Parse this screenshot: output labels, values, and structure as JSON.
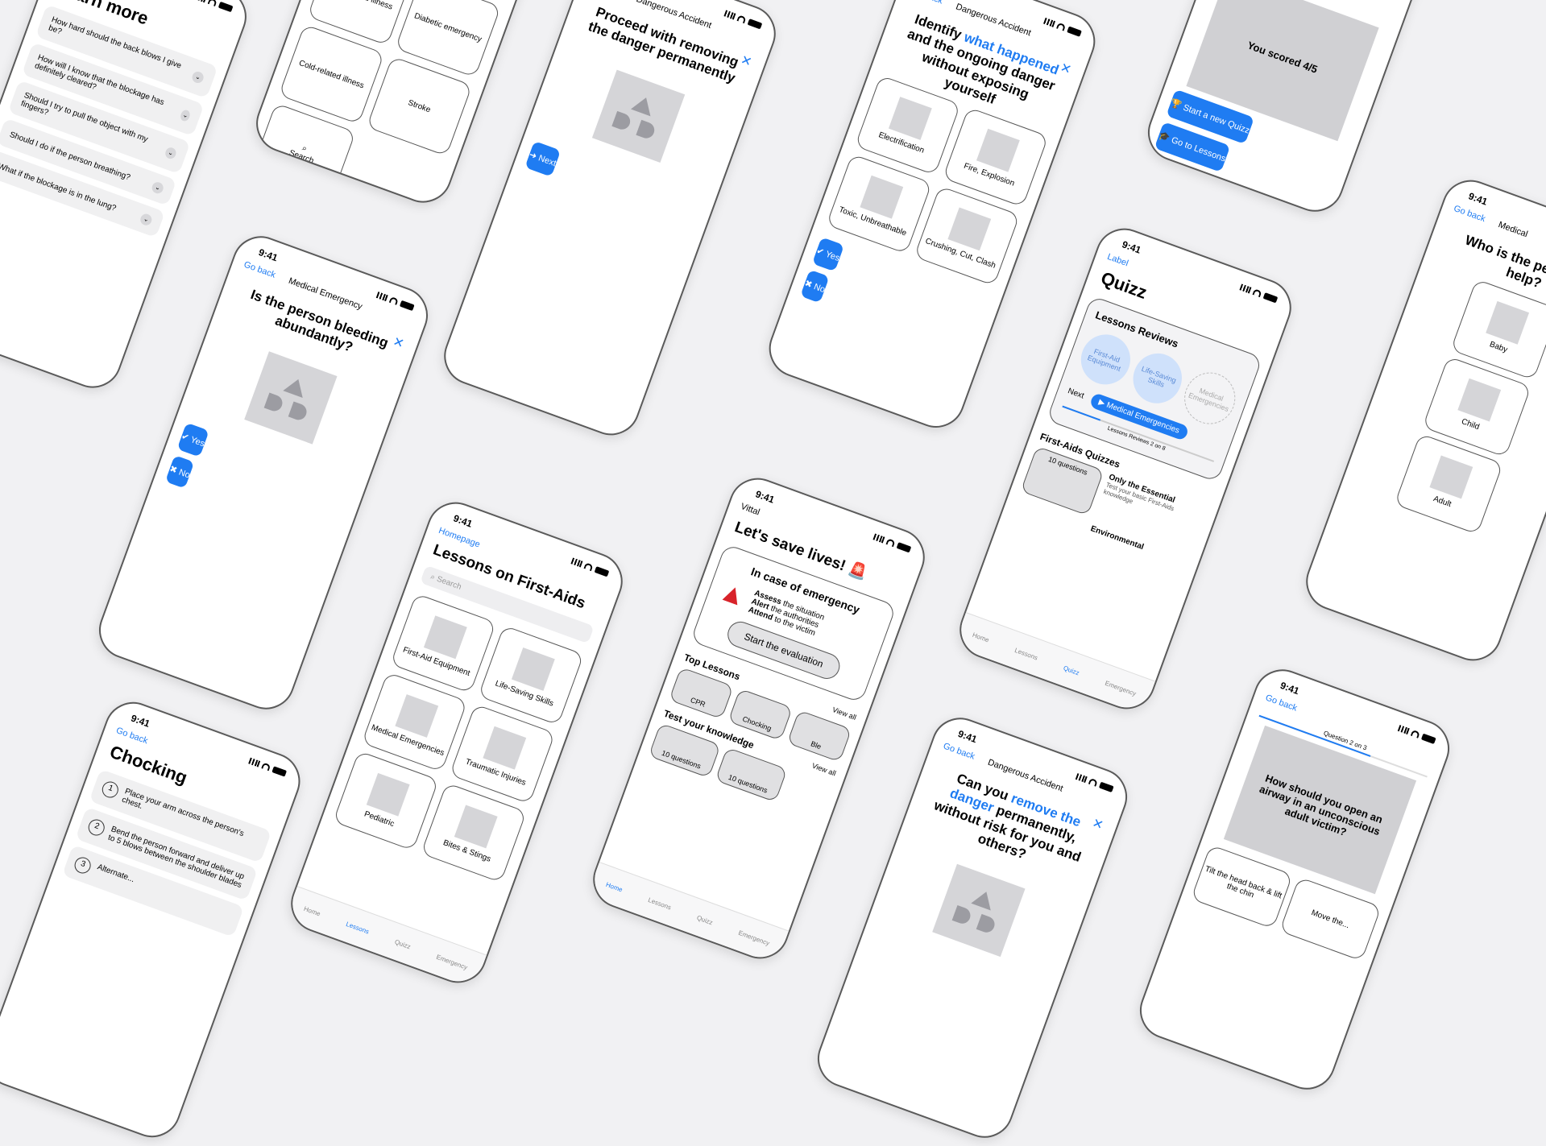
{
  "status": {
    "time": "9:41"
  },
  "common": {
    "go_back": "Go back",
    "yes": "Yes",
    "no": "No",
    "next": "Next",
    "close": "✕"
  },
  "learn": {
    "title": "Learn more",
    "items": [
      "How hard should the back blows I give be?",
      "How will I know that the blockage has definitely cleared?",
      "Should I try to pull the object with my fingers?",
      "Should I do if the person breathing?",
      "What if the blockage is in the lung?"
    ]
  },
  "categories": {
    "items": [
      "Cold-related illness",
      "Diabetic emergency",
      "Cold-related illness",
      "Stroke",
      "Search"
    ]
  },
  "medical": {
    "nav": "Medical Emergency",
    "question": "Is the person bleeding abundantly?"
  },
  "danger1": {
    "nav": "Dangerous Accident",
    "question": "Proceed with removing the danger permanently"
  },
  "identify": {
    "nav": "Dangerous Accident",
    "q1": "Identify ",
    "q2": "what happened",
    "q3": " and the ongoing danger without exposing yourself",
    "opts": [
      "Electrification",
      "Fire, Explosion",
      "Toxic, Unbreathable",
      "Crushing, Cut, Clash"
    ]
  },
  "score": {
    "text": "You scored 4/5",
    "start": "Start a new Quizz",
    "lessons": "Go to Lessons"
  },
  "lessons": {
    "back": "Homepage",
    "title": "Lessons on First-Aids",
    "search": "Search",
    "tiles": [
      "First-Aid Equipment",
      "Life-Saving Skills",
      "Medical Emergencies",
      "Traumatic Injuries",
      "Pediatric",
      "Bites & Stings"
    ]
  },
  "home": {
    "brand": "Vittal",
    "title": "Let's save lives! 🚨",
    "card_title": "In case of emergency",
    "l1a": "Assess",
    "l1b": " the situation",
    "l2a": "Alert",
    "l2b": " the authorities",
    "l3a": "Attend",
    "l3b": " to the victim",
    "cta": "Start the evaluation",
    "top": "Top Lessons",
    "view_all": "View all",
    "chips": [
      "CPR",
      "Chocking",
      "Ble"
    ],
    "test": "Test your knowledge",
    "q10": "10 questions"
  },
  "tabs": {
    "home": "Home",
    "lessons": "Lessons",
    "quizz": "Quizz",
    "emergency": "Emergency"
  },
  "quizz": {
    "back": "Label",
    "title": "Quizz",
    "reviews": "Lessons Reviews",
    "c1": "First-Aid Equipment",
    "c2": "Life-Saving Skills",
    "c3": "Medical Emergencies",
    "next": "Next",
    "next_btn": "Medical Emergencies",
    "progress": "Lessons Reviews 2 on 8",
    "fa": "First-Aids Quizzes",
    "essential": "Only the Essential",
    "essential_sub": "Test your basic First-Aids knowledge",
    "env": "Environmental",
    "q10": "10 questions"
  },
  "who": {
    "nav": "Medical",
    "question": "Who is the person to help?",
    "opts": [
      "Baby",
      "Child",
      "Adult"
    ]
  },
  "chocking": {
    "title": "Chocking",
    "steps": [
      "Place your arm across the person's chest.",
      "Bend the person forward and deliver up to 5 blows between the shoulder blades",
      "Alternate..."
    ]
  },
  "remove": {
    "nav": "Dangerous Accident",
    "q1": "Can you ",
    "q2": "remove the danger",
    "q3": " permanently, without risk for you and others?"
  },
  "airway": {
    "progress": "Question 2 on 3",
    "question": "How should you open an airway in an unconscious adult victim?",
    "opts": [
      "Tilt the head back & lift the chin",
      "Move the..."
    ]
  }
}
